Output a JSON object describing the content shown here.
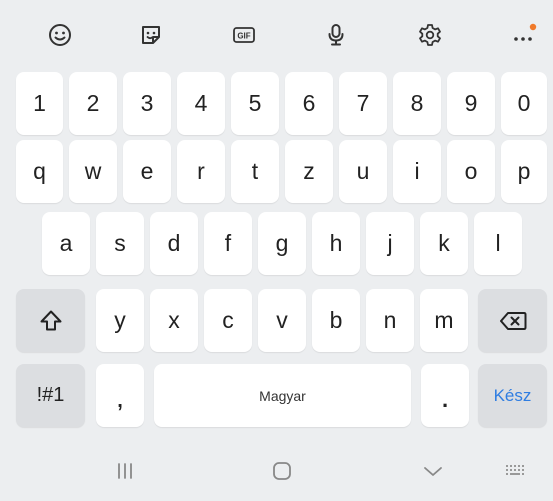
{
  "toolbar": {
    "items": [
      {
        "icon": "emoji-icon"
      },
      {
        "icon": "sticker-icon"
      },
      {
        "icon": "gif-icon",
        "label": "GIF"
      },
      {
        "icon": "microphone-icon"
      },
      {
        "icon": "gear-icon"
      },
      {
        "icon": "more-icon"
      }
    ],
    "notification_dot_color": "#f07a2a"
  },
  "keyboard": {
    "row_numbers": [
      "1",
      "2",
      "3",
      "4",
      "5",
      "6",
      "7",
      "8",
      "9",
      "0"
    ],
    "row_top": [
      "q",
      "w",
      "e",
      "r",
      "t",
      "z",
      "u",
      "i",
      "o",
      "p"
    ],
    "row_home": [
      "a",
      "s",
      "d",
      "f",
      "g",
      "h",
      "j",
      "k",
      "l"
    ],
    "row_bottom": [
      "y",
      "x",
      "c",
      "v",
      "b",
      "n",
      "m"
    ],
    "shift_icon": "shift-icon",
    "backspace_icon": "backspace-icon",
    "symbols_label": "!#1",
    "comma_label": ",",
    "space_label": "Magyar",
    "period_label": ".",
    "enter_label": "Kész",
    "enter_color": "#2f7de1"
  },
  "navbar": {
    "items": [
      {
        "icon": "recent-apps-icon"
      },
      {
        "icon": "home-icon"
      },
      {
        "icon": "hide-keyboard-icon"
      },
      {
        "icon": "keyboard-switch-icon"
      }
    ]
  }
}
